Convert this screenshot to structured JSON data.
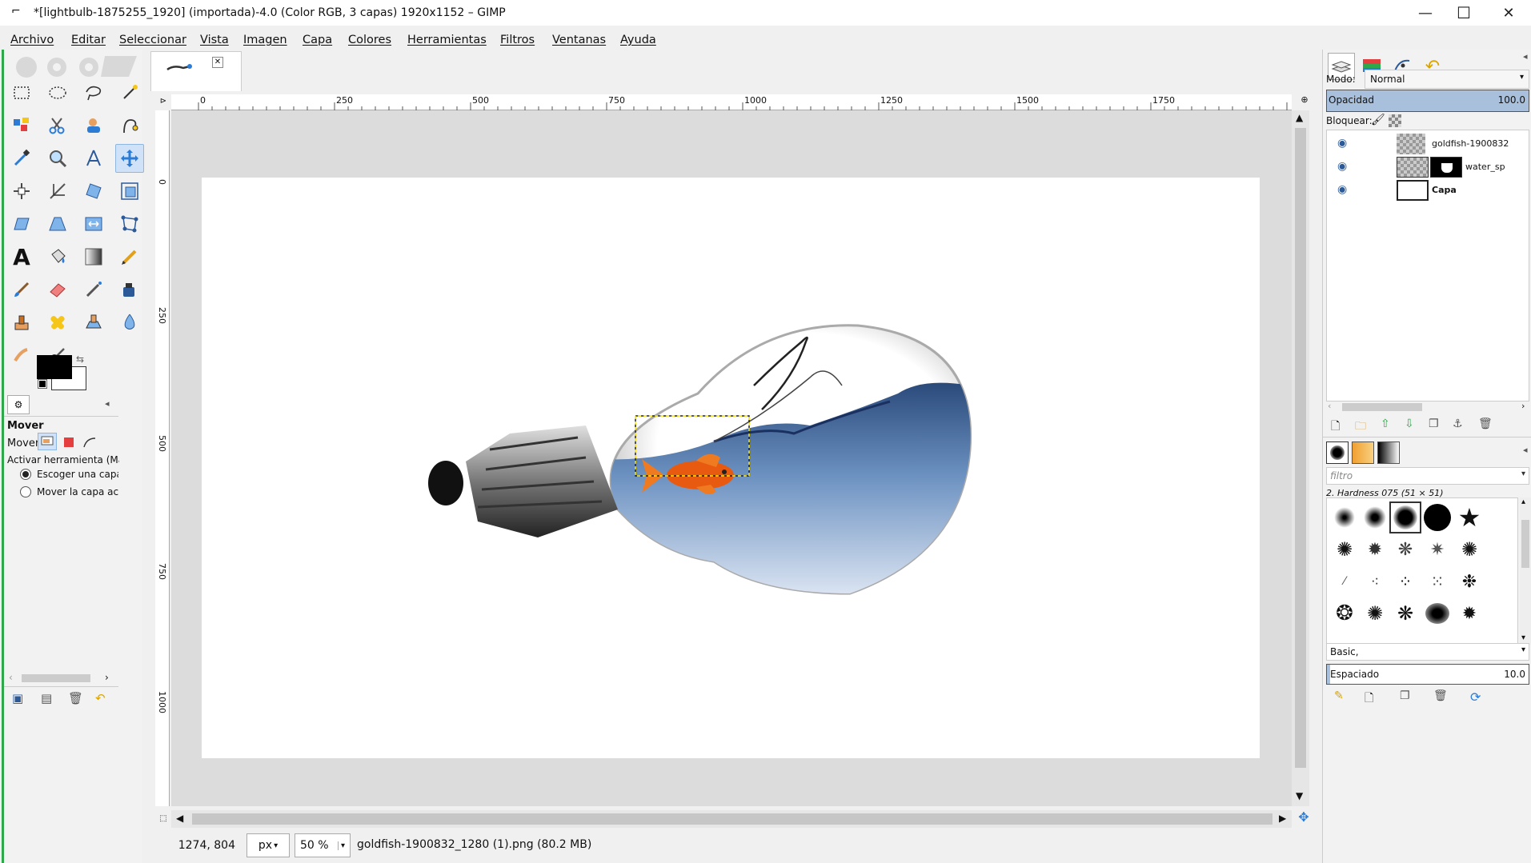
{
  "window": {
    "title": "*[lightbulb-1875255_1920] (importada)-4.0 (Color RGB, 3 capas) 1920x1152 – GIMP",
    "minimize": "—",
    "maximize": "☐",
    "close": "✕"
  },
  "menu": [
    "Archivo",
    "Editar",
    "Seleccionar",
    "Vista",
    "Imagen",
    "Capa",
    "Colores",
    "Herramientas",
    "Filtros",
    "Ventanas",
    "Ayuda"
  ],
  "tool_options": {
    "title": "Mover",
    "mover_label": "Mover:",
    "activar": "Activar herramienta  (Mayús",
    "option1": "Escoger una capa o",
    "option2": "Mover la capa activa",
    "option1_selected": true
  },
  "ruler": {
    "top_ticks": [
      "0",
      "250",
      "500",
      "750",
      "1000",
      "1250",
      "1500",
      "1750"
    ],
    "left_ticks": [
      "0",
      "250",
      "500",
      "750",
      "1000"
    ]
  },
  "status": {
    "coords": "1274, 804",
    "unit": "px",
    "zoom": "50 %",
    "message": "goldfish-1900832_1280 (1).png (80.2 MB)"
  },
  "layers_panel": {
    "mode_label": "Modo:",
    "mode_value": "Normal",
    "opacity_label": "Opacidad",
    "opacity_value": "100.0",
    "lock_label": "Bloquear:",
    "layers": [
      {
        "name": "goldfish-1900832"
      },
      {
        "name": "water_sp"
      },
      {
        "name": "Capa"
      }
    ]
  },
  "brushes_panel": {
    "filter_placeholder": "filtro",
    "brush_name": "2. Hardness 075 (51 × 51)",
    "preset": "Basic,",
    "spacing_label": "Espaciado",
    "spacing_value": "10.0"
  },
  "colors": {
    "foreground": "#000000",
    "background": "#ffffff",
    "accent": "#2ea84a",
    "selection": "#cfe2f7"
  }
}
